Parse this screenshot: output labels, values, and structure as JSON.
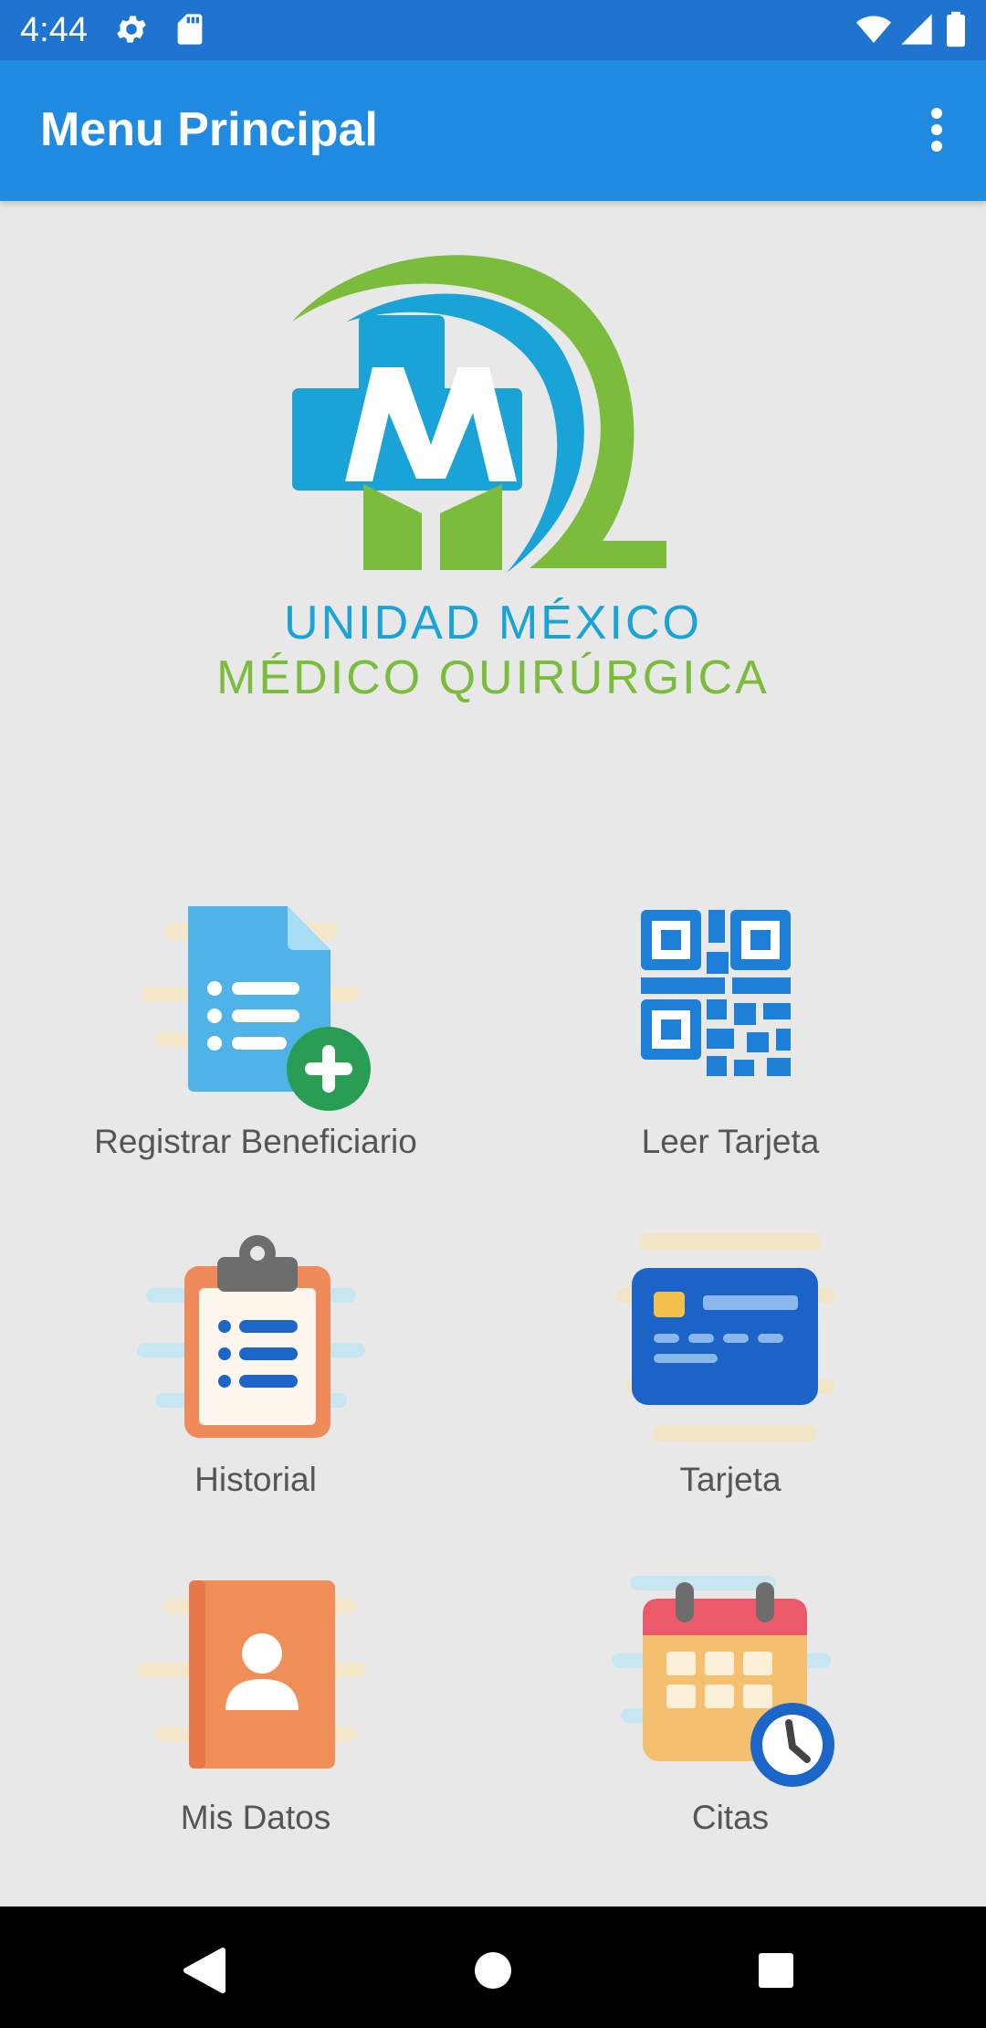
{
  "status_bar": {
    "time": "4:44",
    "left_icons": [
      "settings-icon",
      "sd-card-icon"
    ],
    "right_icons": [
      "wifi-icon",
      "cell-signal-icon",
      "battery-icon"
    ]
  },
  "app_bar": {
    "title": "Menu Principal",
    "overflow_icon": "more-vert-icon",
    "color": "#218be2"
  },
  "logo": {
    "line1": "UNIDAD MÉXICO",
    "line2": "MÉDICO QUIRÚRGICA",
    "colors": {
      "blue": "#1aa3d6",
      "green": "#7cbc3c"
    }
  },
  "menu": {
    "items": [
      {
        "label": "Registrar Beneficiario",
        "icon": "add-document-icon"
      },
      {
        "label": "Leer Tarjeta",
        "icon": "qr-code-icon"
      },
      {
        "label": "Historial",
        "icon": "clipboard-list-icon"
      },
      {
        "label": "Tarjeta",
        "icon": "credit-card-icon"
      },
      {
        "label": "Mis Datos",
        "icon": "contact-book-icon"
      },
      {
        "label": "Citas",
        "icon": "calendar-clock-icon"
      }
    ]
  },
  "nav_bar": {
    "buttons": [
      "back-icon",
      "home-icon",
      "recents-icon"
    ]
  }
}
